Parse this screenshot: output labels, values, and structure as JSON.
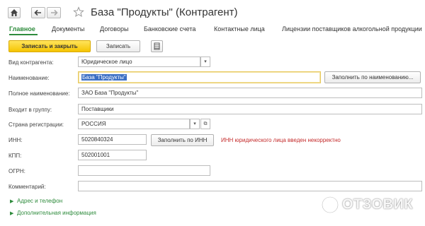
{
  "header": {
    "title": "База \"Продукты\" (Контрагент)"
  },
  "tabs": [
    {
      "label": "Главное"
    },
    {
      "label": "Документы"
    },
    {
      "label": "Договоры"
    },
    {
      "label": "Банковские счета"
    },
    {
      "label": "Контактные лица"
    },
    {
      "label": "Лицензии поставщиков алкогольной продукции"
    }
  ],
  "toolbar": {
    "save_close_label": "Записать и закрыть",
    "save_label": "Записать"
  },
  "form": {
    "kind": {
      "label": "Вид контрагента:",
      "value": "Юридическое лицо"
    },
    "name": {
      "label": "Наименование:",
      "value": "База \"Продукты\""
    },
    "fill_by_name_label": "Заполнить по наименованию...",
    "full_name": {
      "label": "Полное наименование:",
      "value": "ЗАО База \"Продукты\""
    },
    "group": {
      "label": "Входит в группу:",
      "value": "Поставщики"
    },
    "country": {
      "label": "Страна регистрации:",
      "value": "РОССИЯ"
    },
    "inn": {
      "label": "ИНН:",
      "value": "5020840324"
    },
    "fill_by_inn_label": "Заполнить по ИНН",
    "inn_error": "ИНН юридического лица введен некорректно",
    "kpp": {
      "label": "КПП:",
      "value": "502001001"
    },
    "ogrn": {
      "label": "ОГРН:",
      "value": ""
    },
    "comment": {
      "label": "Комментарий:",
      "value": ""
    }
  },
  "groups": [
    {
      "label": "Адрес и телефон"
    },
    {
      "label": "Дополнительная информация"
    }
  ],
  "watermark": "ОТЗОВИК",
  "icons": [
    "home-icon",
    "back-arrow-icon",
    "forward-arrow-icon",
    "star-icon",
    "table-icon",
    "chevron-down-icon",
    "link-icon",
    "chevron-right-icon"
  ]
}
